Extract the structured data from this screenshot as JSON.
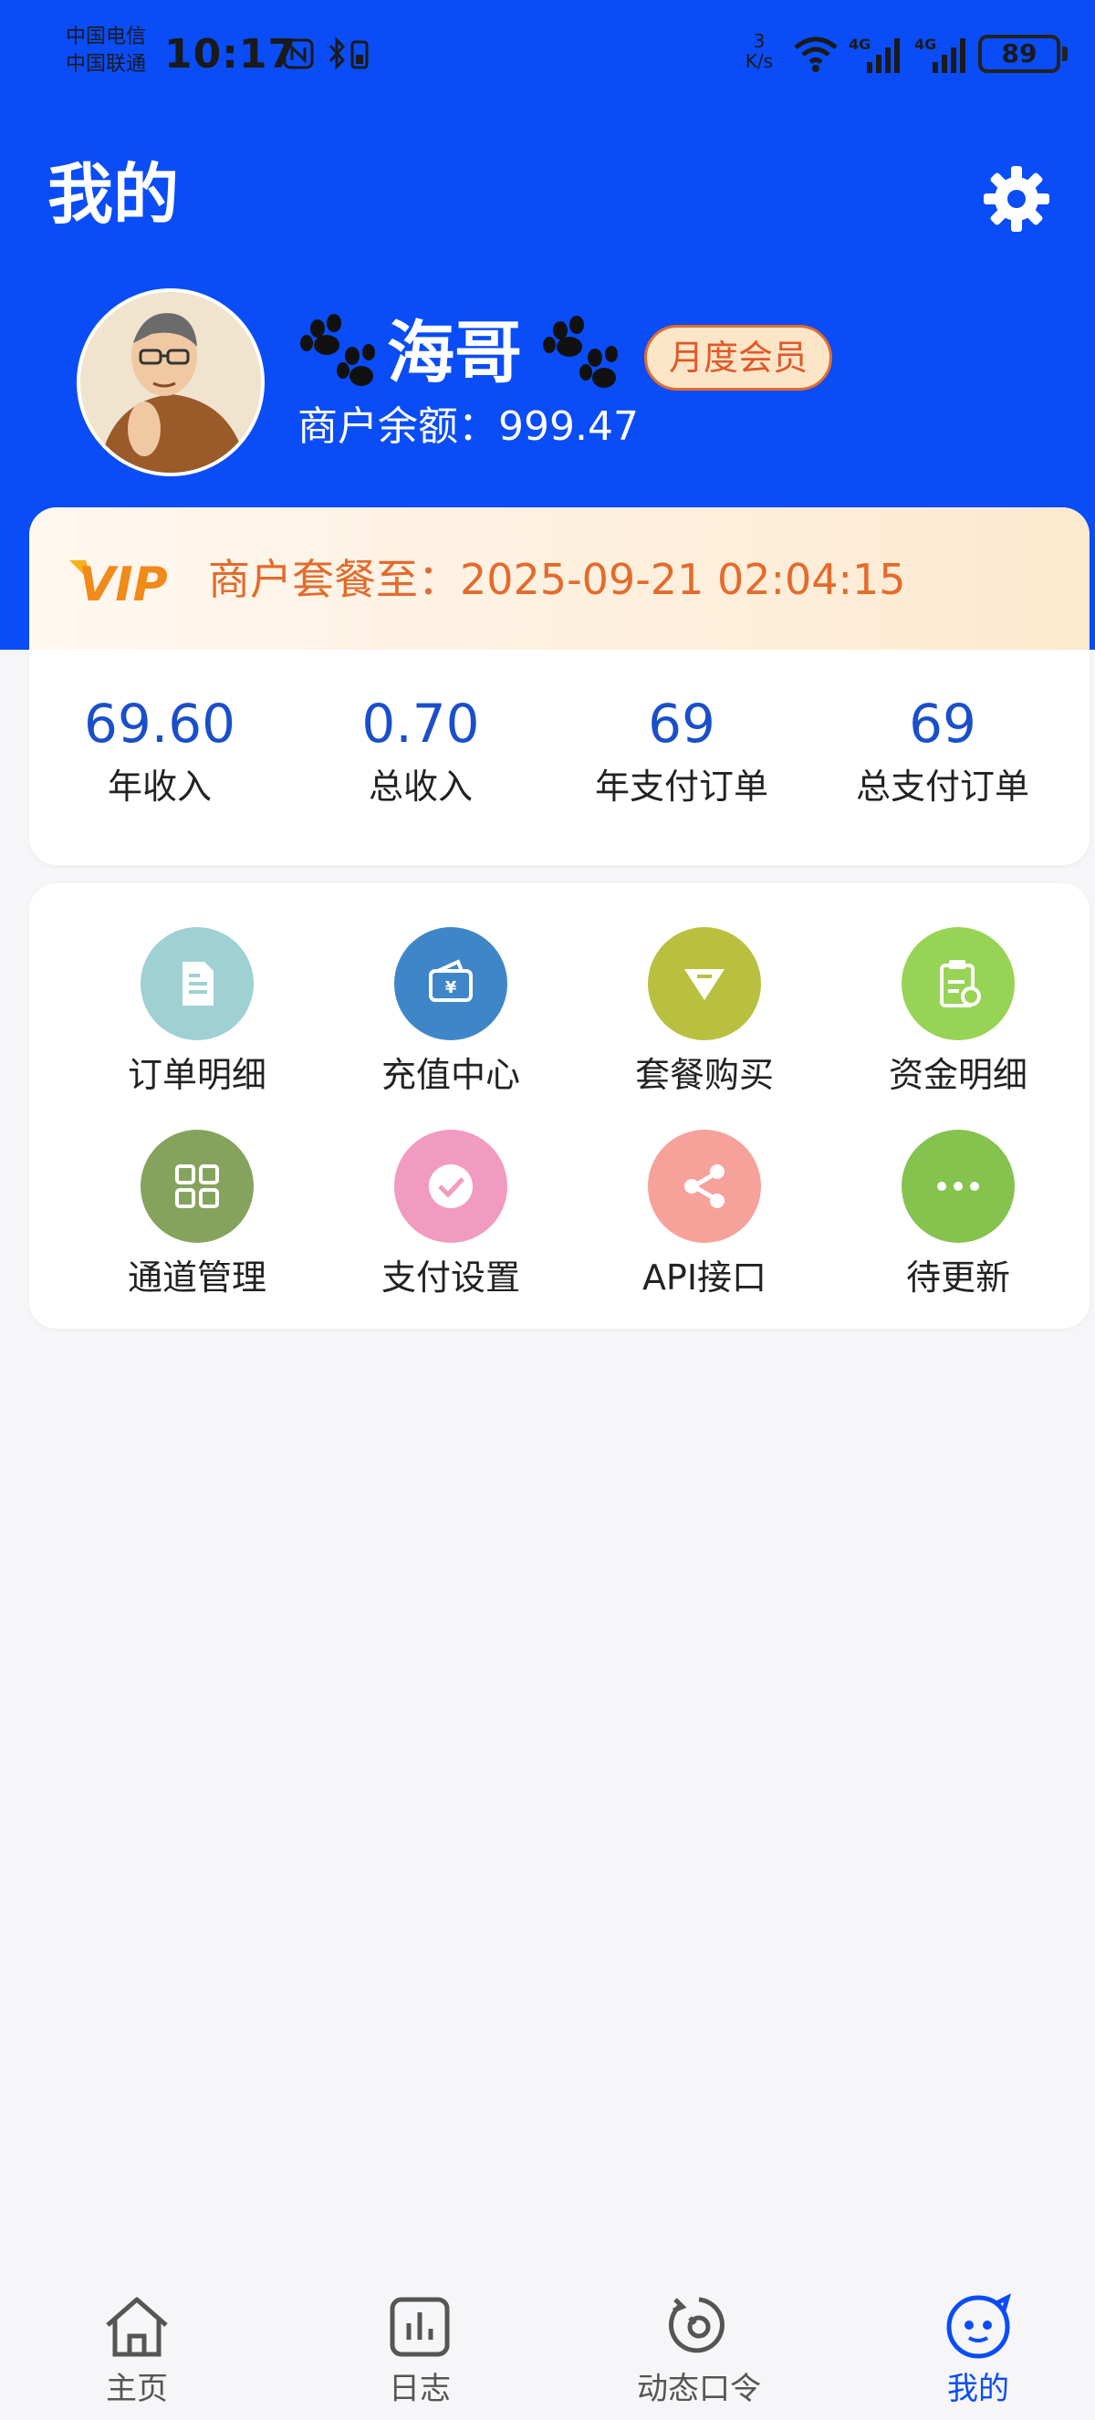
{
  "status_bar": {
    "carrier_1": "中国电信",
    "carrier_2": "中国联通",
    "time": "10:17",
    "speed_value": "3",
    "speed_unit": "K/s",
    "network_1": "4G",
    "network_2": "4G",
    "battery": "89"
  },
  "header": {
    "title": "我的"
  },
  "profile": {
    "name": "海哥",
    "member_badge": "月度会员",
    "balance": "商户余额：999.47"
  },
  "vip": {
    "logo_text": "VIP",
    "expiry_text": "商户套餐至：2025-09-21 02:04:15"
  },
  "stats": [
    {
      "value": "69.60",
      "label": "年收入"
    },
    {
      "value": "0.70",
      "label": "总收入"
    },
    {
      "value": "69",
      "label": "年支付订单"
    },
    {
      "value": "69",
      "label": "总支付订单"
    }
  ],
  "menu": [
    {
      "label": "订单明细",
      "icon": "document-icon",
      "color": "#9fd0d2"
    },
    {
      "label": "充值中心",
      "icon": "wallet-icon",
      "color": "#3f86c8"
    },
    {
      "label": "套餐购买",
      "icon": "diamond-icon",
      "color": "#b9c040"
    },
    {
      "label": "资金明细",
      "icon": "clipboard-icon",
      "color": "#97d455"
    },
    {
      "label": "通道管理",
      "icon": "grid-icon",
      "color": "#86a35e"
    },
    {
      "label": "支付设置",
      "icon": "check-circle-icon",
      "color": "#f29bc0"
    },
    {
      "label": "API接口",
      "icon": "share-icon",
      "color": "#f7a19b"
    },
    {
      "label": "待更新",
      "icon": "more-icon",
      "color": "#86c24e"
    }
  ],
  "bottom_nav": [
    {
      "label": "主页",
      "icon": "home-icon",
      "active": false
    },
    {
      "label": "日志",
      "icon": "chart-icon",
      "active": false
    },
    {
      "label": "动态口令",
      "icon": "token-icon",
      "active": false
    },
    {
      "label": "我的",
      "icon": "smiley-icon",
      "active": true
    }
  ],
  "colors": {
    "primary_blue": "#0a4cf6",
    "stat_blue": "#1a4fc9",
    "vip_orange": "#e36b2c",
    "page_bg": "#f6f6f8"
  }
}
